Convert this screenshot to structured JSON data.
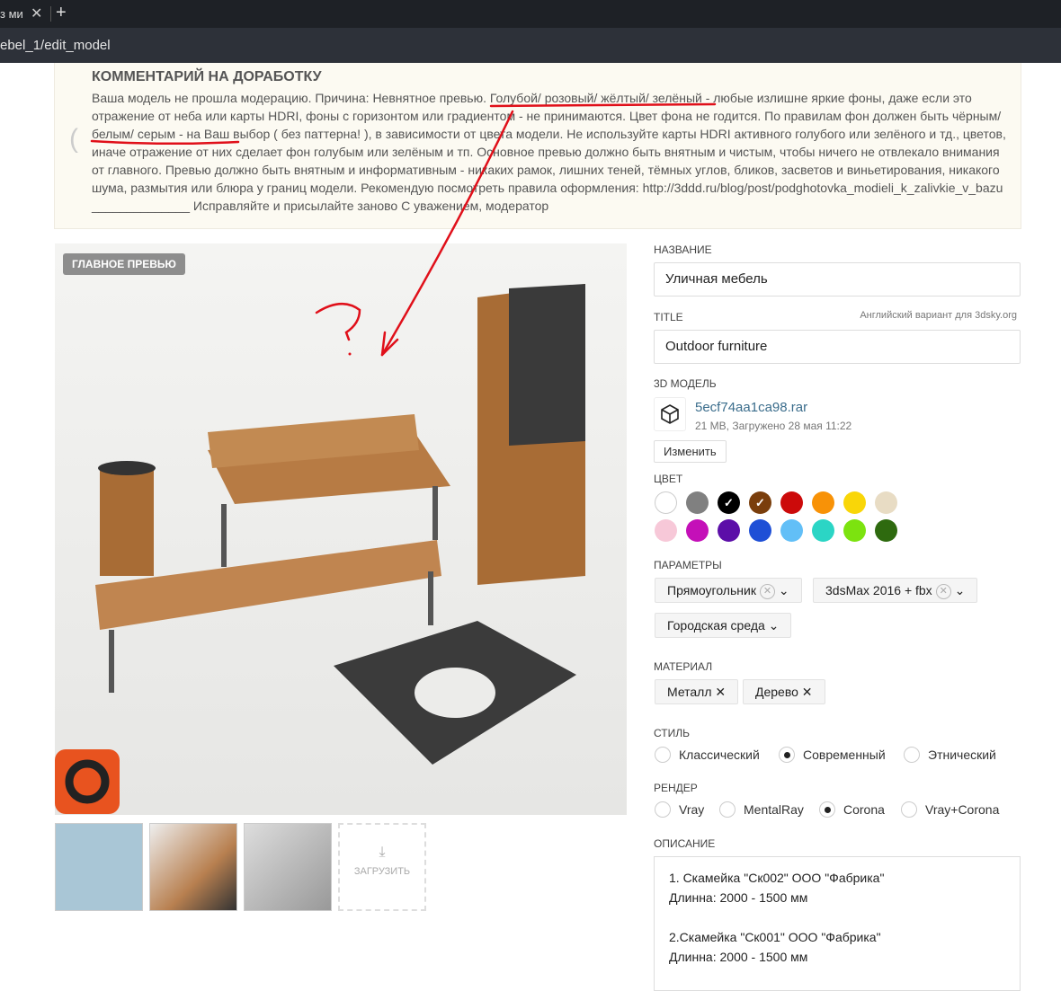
{
  "browser": {
    "tab_title": "з ми",
    "url": "ebel_1/edit_model"
  },
  "comment": {
    "title": "КОММЕНТАРИЙ НА ДОРАБОТКУ",
    "text": "Ваша модель не прошла модерацию. Причина: Невнятное превью. Голубой/ розовый/ жёлтый/ зелёный - любые излишне яркие фоны, даже если это отражение от неба или карты HDRI, фоны с горизонтом или градиентом - не принимаются. Цвет фона не годится. По правилам фон должен быть чёрным/ белым/ серым - на Ваш выбор ( без паттерна! ), в зависимости от цвета модели. Не используйте карты HDRI активного голубого или зелёного и тд., цветов, иначе отражение от них сделает фон голубым или зелёным и тп. Основное превью должно быть внятным и чистым, чтобы ничего не отвлекало внимания от главного. Превью должно быть внятным и информативным - никаких рамок, лишних теней, тёмных углов, бликов, засветов и виньетирования, никакого шума, размытия или блюра у границ модели. Рекомендую посмотреть правила оформления: http://3ddd.ru/blog/post/podghotovka_modieli_k_zalivkie_v_bazu ______________ Исправляйте и присылайте заново С уважением, модератор"
  },
  "preview": {
    "badge": "ГЛАВНОЕ ПРЕВЬЮ",
    "upload_label": "ЗАГРУЗИТЬ"
  },
  "form": {
    "name_label": "НАЗВАНИЕ",
    "name_value": "Уличная мебель",
    "title_label": "TITLE",
    "title_hint": "Английский вариант для 3dsky.org",
    "title_value": "Outdoor furniture",
    "model_label": "3D МОДЕЛЬ",
    "file_name": "5ecf74aa1ca98.rar",
    "file_meta": "21 MB, Загружено 28 мая 11:22",
    "change_button": "Изменить",
    "color_label": "ЦВЕТ",
    "colors": [
      {
        "hex": "#ffffff",
        "checked": false
      },
      {
        "hex": "#808080",
        "checked": false
      },
      {
        "hex": "#000000",
        "checked": true
      },
      {
        "hex": "#7a3e0c",
        "checked": true
      },
      {
        "hex": "#cc0a0a",
        "checked": false
      },
      {
        "hex": "#f89207",
        "checked": false
      },
      {
        "hex": "#f9d608",
        "checked": false
      },
      {
        "hex": "#e8dcc4",
        "checked": false
      },
      {
        "hex": "#f7c8d8",
        "checked": false
      },
      {
        "hex": "#c410b8",
        "checked": false
      },
      {
        "hex": "#5c0ea8",
        "checked": false
      },
      {
        "hex": "#1e4fd6",
        "checked": false
      },
      {
        "hex": "#62bff7",
        "checked": false
      },
      {
        "hex": "#2bd5c5",
        "checked": false
      },
      {
        "hex": "#7ce30f",
        "checked": false
      },
      {
        "hex": "#2e6a0f",
        "checked": false
      }
    ],
    "params_label": "ПАРАМЕТРЫ",
    "params": [
      "Прямоугольник",
      "3dsMax 2016 + fbx",
      "Городская среда"
    ],
    "material_label": "МАТЕРИАЛ",
    "materials": [
      "Металл",
      "Дерево"
    ],
    "style_label": "СТИЛЬ",
    "styles": [
      "Классический",
      "Современный",
      "Этнический"
    ],
    "style_selected": "Современный",
    "render_label": "РЕНДЕР",
    "renders": [
      "Vray",
      "MentalRay",
      "Corona",
      "Vray+Corona"
    ],
    "render_selected": "Corona",
    "desc_label": "ОПИСАНИЕ",
    "desc_value": "1. Скамейка \"Ск002\" ООО \"Фабрика\"\nДлинна: 2000 - 1500 мм\n\n2.Скамейка \"Ск001\" ООО \"Фабрика\"\nДлинна: 2000 - 1500 мм"
  }
}
